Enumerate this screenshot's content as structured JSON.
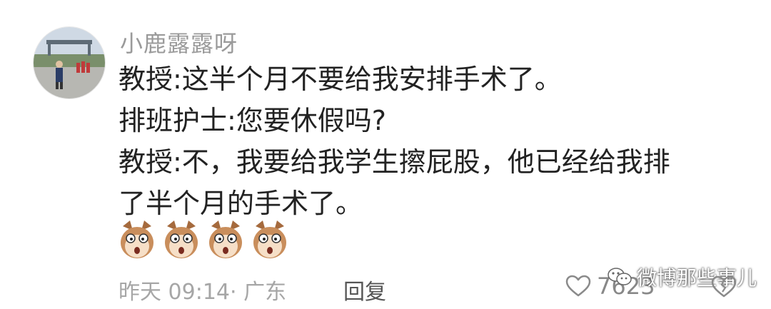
{
  "comment": {
    "username": "小鹿露露呀",
    "lines": [
      "教授:这半个月不要给我安排手术了。",
      "排班护士:您要休假吗?",
      "教授:不，我要给我学生擦屁股，他已经给我排",
      "了半个月的手术了。"
    ],
    "emoji_names": [
      "dog-face-emoji",
      "dog-face-emoji",
      "dog-face-emoji",
      "dog-face-emoji"
    ],
    "meta": "昨天 09:14· 广东",
    "reply_label": "回复",
    "like_count": "7623"
  },
  "watermark": {
    "text": "微博那些事儿"
  },
  "icons": {
    "like": "heart-outline-icon",
    "dislike": "broken-heart-icon",
    "watermark": "wechat-icon"
  },
  "colors": {
    "username": "#9a9a9a",
    "body_text": "#222222",
    "meta": "#a6a6a6",
    "reply": "#555555"
  }
}
